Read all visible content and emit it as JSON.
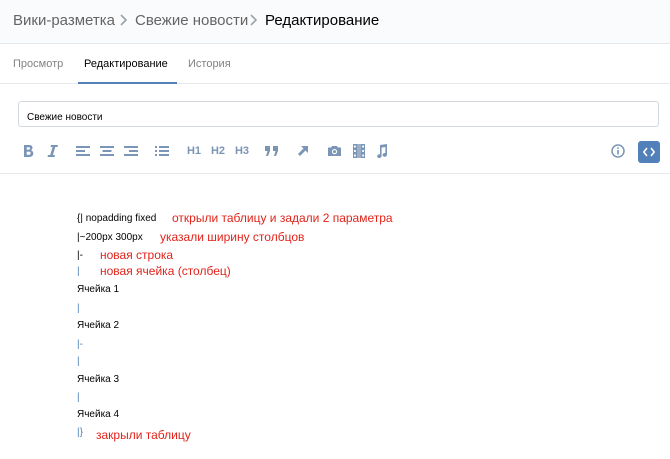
{
  "breadcrumb": {
    "section": "Вики-разметка",
    "page": "Свежие новости",
    "current": "Редактирование"
  },
  "tabs": [
    {
      "label": "Просмотр",
      "active": false
    },
    {
      "label": "Редактирование",
      "active": true
    },
    {
      "label": "История",
      "active": false
    }
  ],
  "title_input": {
    "value": "Свежие новости"
  },
  "toolbar": {
    "h1": "H1",
    "h2": "H2",
    "h3": "H3",
    "icons": [
      "bold-icon",
      "italic-icon",
      "align-left-icon",
      "align-center-icon",
      "align-right-icon",
      "list-icon",
      "h1-icon",
      "h2-icon",
      "h3-icon",
      "quote-icon",
      "link-icon",
      "photo-icon",
      "video-icon",
      "audio-icon",
      "info-icon",
      "code-mode-icon"
    ]
  },
  "editor": {
    "lines": [
      "{| nopadding fixed",
      "|~200px 300px",
      "|-",
      "|",
      "Ячейка 1",
      "|",
      "Ячейка 2",
      "|-",
      "|",
      "Ячейка 3",
      "|",
      "Ячейка 4",
      "|}"
    ],
    "annotations": [
      "открыли таблицу и задали 2 параметра",
      "указали ширину столбцов",
      "новая строка",
      "новая ячейка (столбец)",
      "закрыли таблицу"
    ]
  },
  "colors": {
    "accent": "#5181b8",
    "icon": "#7a95b5",
    "annotation": "#e2231a"
  }
}
